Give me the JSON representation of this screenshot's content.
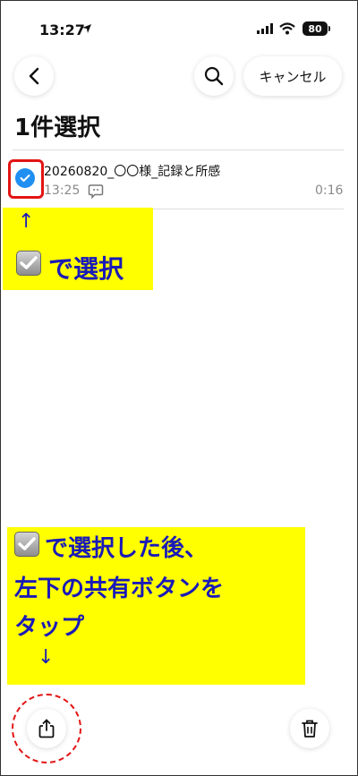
{
  "status_bar": {
    "time": "13:27",
    "battery": "80"
  },
  "header": {
    "back_icon": "chevron-left-icon",
    "search_icon": "search-icon",
    "cancel_label": "キャンセル"
  },
  "page": {
    "title": "1件選択"
  },
  "list": {
    "items": [
      {
        "title": "20260820_〇〇様_記録と所感",
        "time": "13:25",
        "duration": "0:16",
        "selected": true
      }
    ]
  },
  "annotations": {
    "top_arrow": "↑",
    "top_text": "で選択",
    "bottom_lines": [
      "で選択した後、",
      "左下の共有ボタンを",
      "タップ"
    ],
    "bottom_arrow": "↓"
  },
  "colors": {
    "accent_blue": "#1f8ff2",
    "highlight_red": "#e31414",
    "annotation_yellow": "#ffff00",
    "annotation_text": "#1a1ab8"
  },
  "toolbar": {
    "share_icon": "share-icon",
    "trash_icon": "trash-icon"
  }
}
